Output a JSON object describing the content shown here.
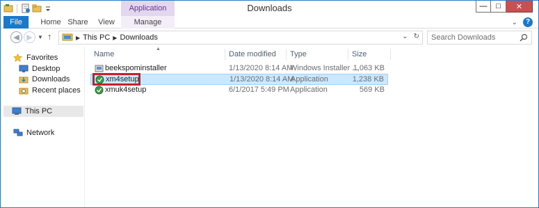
{
  "window": {
    "title": "Downloads",
    "contextual_tab_group": "Application Tools",
    "controls": {
      "minimize": "—",
      "maximize": "□",
      "close": "✕"
    }
  },
  "ribbon": {
    "tabs": [
      {
        "label": "File"
      },
      {
        "label": "Home"
      },
      {
        "label": "Share"
      },
      {
        "label": "View"
      },
      {
        "label": "Manage"
      }
    ],
    "expand_glyph": "⌄",
    "help_glyph": "?"
  },
  "navigation": {
    "back_glyph": "◀",
    "forward_glyph": "▶",
    "recent_glyph": "▼",
    "up_glyph": "↑",
    "breadcrumbs": [
      "This PC",
      "Downloads"
    ],
    "crumb_sep": "▶",
    "dropdown_glyph": "⌄",
    "refresh_glyph": "↻"
  },
  "search": {
    "placeholder": "Search Downloads"
  },
  "nav_pane": {
    "favorites": "Favorites",
    "desktop": "Desktop",
    "downloads": "Downloads",
    "recent_places": "Recent places",
    "this_pc": "This PC",
    "network": "Network"
  },
  "file_list": {
    "sort_glyph": "▲",
    "columns": {
      "name": "Name",
      "date": "Date modified",
      "type": "Type",
      "size": "Size"
    },
    "rows": [
      {
        "name": "beekspominstaller",
        "date": "1/13/2020 8:14 AM",
        "type": "Windows Installer ...",
        "size": "1,063 KB",
        "selected": false,
        "icon": "installer-icon"
      },
      {
        "name": "xm4setup",
        "date": "1/13/2020 8:14 AM",
        "type": "Application",
        "size": "1,238 KB",
        "selected": true,
        "icon": "app-icon"
      },
      {
        "name": "xmuk4setup",
        "date": "6/1/2017 5:49 PM",
        "type": "Application",
        "size": "569 KB",
        "selected": false,
        "icon": "app-icon"
      }
    ]
  },
  "colors": {
    "file_tab": "#1979ca",
    "context_tab": "#e3d7ef",
    "selection_fill": "#cce8ff",
    "highlight_box": "#c8202a"
  }
}
